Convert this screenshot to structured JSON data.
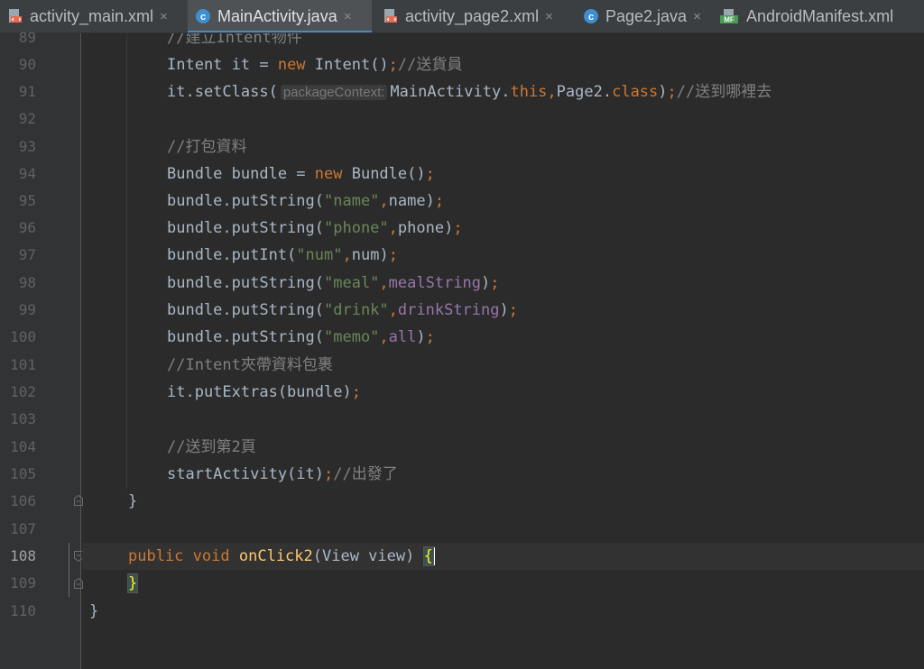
{
  "tabs": [
    {
      "label": "activity_main.xml",
      "icon": "xml-layout-icon",
      "active": false
    },
    {
      "label": "MainActivity.java",
      "icon": "java-class-icon",
      "active": true
    },
    {
      "label": "activity_page2.xml",
      "icon": "xml-layout-icon",
      "active": false
    },
    {
      "label": "Page2.java",
      "icon": "java-class-icon",
      "active": false
    },
    {
      "label": "AndroidManifest.xml",
      "icon": "manifest-icon",
      "active": false
    }
  ],
  "tab_close_glyph": "×",
  "current_line": "108",
  "line_numbers": [
    "89",
    "90",
    "91",
    "92",
    "93",
    "94",
    "95",
    "96",
    "97",
    "98",
    "99",
    "100",
    "101",
    "102",
    "103",
    "104",
    "105",
    "106",
    "107",
    "108",
    "109",
    "110"
  ],
  "code": {
    "l89": "//建立Intent物件",
    "l90": {
      "p1": "Intent it = ",
      "kw": "new",
      "p2": " Intent()",
      "semi": ";",
      "cmt": "//送貨員"
    },
    "l91": {
      "p1": "it.setClass(",
      "hint": "packageContext:",
      "p2": "MainActivity.",
      "kw1": "this",
      "comma": ",",
      "p3": "Page2.",
      "kw2": "class",
      "p4": ")",
      "semi": ";",
      "cmt": "//送到哪裡去"
    },
    "l93": "//打包資料",
    "l94": {
      "p1": "Bundle bundle = ",
      "kw": "new",
      "p2": " Bundle()",
      "semi": ";"
    },
    "l95": {
      "p1": "bundle.putString(",
      "str": "\"name\"",
      "comma": ",",
      "arg": "name",
      "p2": ")",
      "semi": ";"
    },
    "l96": {
      "p1": "bundle.putString(",
      "str": "\"phone\"",
      "comma": ",",
      "arg": "phone",
      "p2": ")",
      "semi": ";"
    },
    "l97": {
      "p1": "bundle.putInt(",
      "str": "\"num\"",
      "comma": ",",
      "arg": "num",
      "p2": ")",
      "semi": ";"
    },
    "l98": {
      "p1": "bundle.putString(",
      "str": "\"meal\"",
      "comma": ",",
      "arg": "mealString",
      "p2": ")",
      "semi": ";"
    },
    "l99": {
      "p1": "bundle.putString(",
      "str": "\"drink\"",
      "comma": ",",
      "arg": "drinkString",
      "p2": ")",
      "semi": ";"
    },
    "l100": {
      "p1": "bundle.putString(",
      "str": "\"memo\"",
      "comma": ",",
      "arg": "all",
      "p2": ")",
      "semi": ";"
    },
    "l101": "//Intent夾帶資料包裹",
    "l102": {
      "p1": "it.putExtras(bundle)",
      "semi": ";"
    },
    "l104": "//送到第2頁",
    "l105": {
      "p1": "startActivity(it)",
      "semi": ";",
      "cmt": "//出發了"
    },
    "l106": "}",
    "l108": {
      "kw1": "public",
      "kw2": "void",
      "fn": "onClick2",
      "p1": "(View view) ",
      "brace": "{"
    },
    "l109": "}",
    "l110": "}"
  },
  "colors": {
    "background": "#2b2b2b",
    "gutter": "#313335",
    "keyword": "#cc7832",
    "string": "#6a8759",
    "comment": "#808080",
    "field": "#9876aa",
    "method": "#ffc66d",
    "text": "#a9b7c6",
    "tab_accent": "#4a88c7"
  }
}
